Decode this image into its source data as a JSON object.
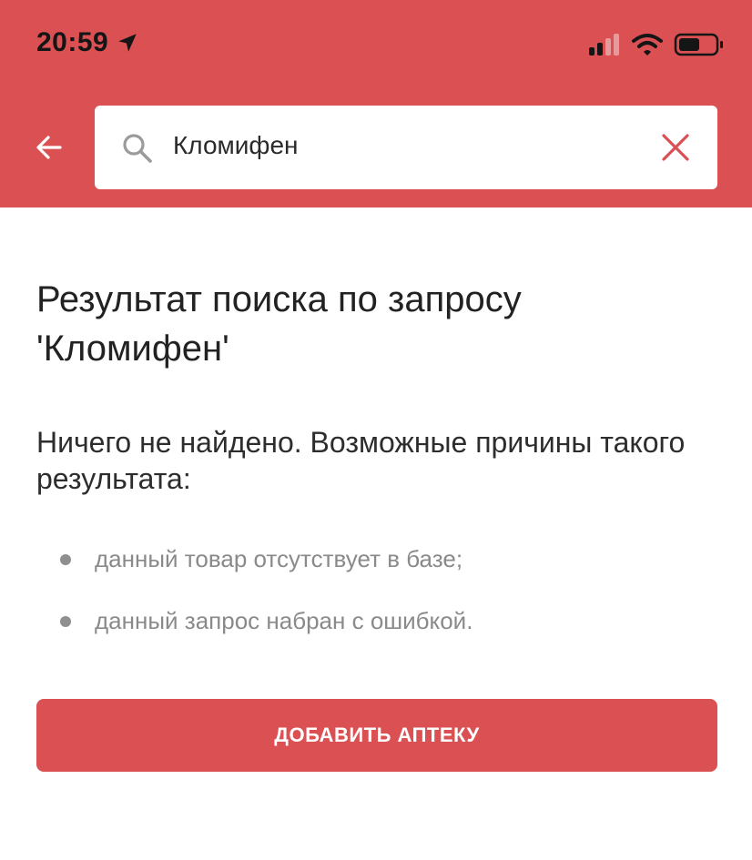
{
  "status_bar": {
    "time": "20:59",
    "location_icon": "location-arrow-icon",
    "signal_icon": "cellular-signal-icon",
    "wifi_icon": "wifi-icon",
    "battery_icon": "battery-icon"
  },
  "header": {
    "background_color": "#db5153",
    "back_icon": "back-arrow-icon",
    "search": {
      "value": "Кломифен",
      "search_icon": "search-icon",
      "clear_icon": "close-icon",
      "clear_color": "#db5153"
    }
  },
  "main": {
    "title": "Результат поиска по запросу 'Кломифен'",
    "subtitle": "Ничего не найдено. Возможные причины такого результата:",
    "reasons": [
      "данный товар отсутствует в базе;",
      "данный запрос набран с ошибкой."
    ],
    "add_button_label": "ДОБАВИТЬ АПТЕКУ"
  }
}
